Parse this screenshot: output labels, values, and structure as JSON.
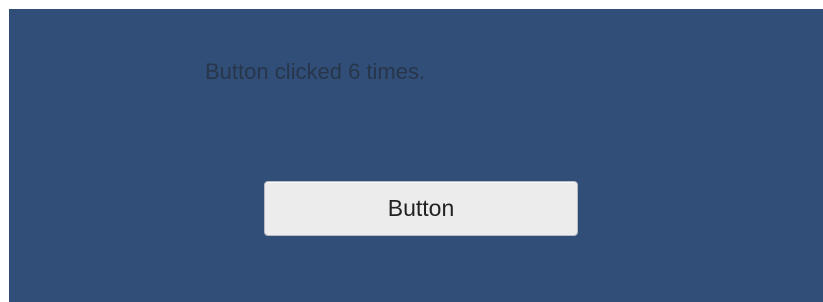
{
  "status_text": "Button clicked 6 times.",
  "button": {
    "label": "Button"
  },
  "colors": {
    "panel_background": "#314e78",
    "status_text": "#27364a",
    "button_background": "#ececec"
  }
}
